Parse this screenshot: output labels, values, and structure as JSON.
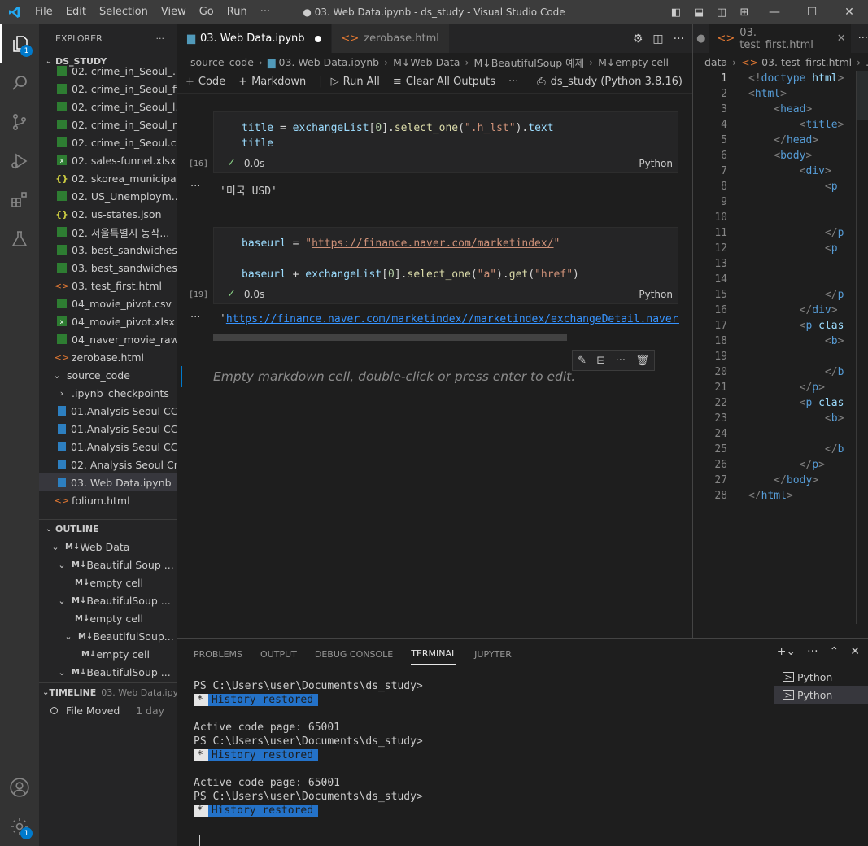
{
  "window": {
    "title": "● 03. Web Data.ipynb - ds_study - Visual Studio Code",
    "menu": [
      "File",
      "Edit",
      "Selection",
      "View",
      "Go",
      "Run",
      "···"
    ]
  },
  "activity": {
    "explorer_badge": "1",
    "settings_badge": "1"
  },
  "explorer": {
    "header": "EXPLORER",
    "header_more": "···",
    "folder": "DS_STUDY",
    "files": [
      {
        "name": "02. crime_in_Seoul_...",
        "type": "csv"
      },
      {
        "name": "02. crime_in_Seoul_fi...",
        "type": "csv"
      },
      {
        "name": "02. crime_in_Seoul_l...",
        "type": "csv"
      },
      {
        "name": "02. crime_in_Seoul_r...",
        "type": "csv"
      },
      {
        "name": "02. crime_in_Seoul.csv",
        "type": "csv"
      },
      {
        "name": "02. sales-funnel.xlsx",
        "type": "xlsx"
      },
      {
        "name": "02. skorea_municipa...",
        "type": "json"
      },
      {
        "name": "02. US_Unemploym...",
        "type": "csv"
      },
      {
        "name": "02. us-states.json",
        "type": "json"
      },
      {
        "name": "02. 서울특별시 동작...",
        "type": "csv"
      },
      {
        "name": "03. best_sandwiches...",
        "type": "csv"
      },
      {
        "name": "03. best_sandwiches...",
        "type": "csv"
      },
      {
        "name": "03. test_first.html",
        "type": "html"
      },
      {
        "name": "04_movie_pivot.csv",
        "type": "csv"
      },
      {
        "name": "04_movie_pivot.xlsx",
        "type": "xlsx"
      },
      {
        "name": "04_naver_movie_raw...",
        "type": "csv"
      },
      {
        "name": "zerobase.html",
        "type": "html"
      }
    ],
    "subfolder": "source_code",
    "subfiles": [
      {
        "name": ".ipynb_checkpoints",
        "type": "folder"
      },
      {
        "name": "01.Analysis Seoul CC...",
        "type": "nb"
      },
      {
        "name": "01.Analysis Seoul CC...",
        "type": "nb"
      },
      {
        "name": "01.Analysis Seoul CC...",
        "type": "nb"
      },
      {
        "name": "02. Analysis Seoul Cr...",
        "type": "nb"
      },
      {
        "name": "03. Web Data.ipynb",
        "type": "nb",
        "selected": true
      },
      {
        "name": "folium.html",
        "type": "html"
      }
    ]
  },
  "outline": {
    "header": "OUTLINE",
    "items": [
      {
        "label": "Web Data",
        "indent": 0,
        "chevron": true
      },
      {
        "label": "Beautiful Soup ...",
        "indent": 1,
        "chevron": true
      },
      {
        "label": "empty cell",
        "indent": 2,
        "chevron": false
      },
      {
        "label": "BeautifulSoup ...",
        "indent": 1,
        "chevron": true
      },
      {
        "label": "empty cell",
        "indent": 2,
        "chevron": false
      },
      {
        "label": "BeautifulSoup...",
        "indent": 2,
        "chevron": true
      },
      {
        "label": "empty cell",
        "indent": 3,
        "chevron": false
      },
      {
        "label": "BeautifulSoup ...",
        "indent": 1,
        "chevron": true
      }
    ]
  },
  "timeline": {
    "header": "TIMELINE",
    "file": "03. Web Data.ipy...",
    "event": "File Moved",
    "when": "1 day"
  },
  "editor1": {
    "tabs": [
      {
        "label": "03. Web Data.ipynb",
        "active": true,
        "dirty": true
      },
      {
        "label": "zerobase.html",
        "active": false
      }
    ],
    "breadcrumb": [
      "source_code",
      "03. Web Data.ipynb",
      "M↓Web Data",
      "M↓BeautifulSoup 예제",
      "M↓empty cell"
    ],
    "toolbar": {
      "code": "Code",
      "markdown": "Markdown",
      "run_all": "Run All",
      "clear_outputs": "Clear All Outputs",
      "more": "···",
      "kernel": "ds_study (Python 3.8.16)"
    },
    "cells": [
      {
        "exec": "[16]",
        "time": "0.0s",
        "lang": "Python",
        "output": "'미국 USD'"
      },
      {
        "exec": "[19]",
        "time": "0.0s",
        "lang": "Python",
        "output_prefix": "'",
        "output_link": "https://finance.naver.com/marketindex//marketindex/exchangeDetail.naver?r"
      }
    ],
    "markdown_placeholder": "Empty markdown cell, double-click or press enter to edit."
  },
  "editor2": {
    "tab": "03. test_first.html",
    "breadcrumb": [
      "data",
      "03. test_first.html",
      "..."
    ],
    "line_numbers": [
      "1",
      "2",
      "3",
      "4",
      "5",
      "6",
      "7",
      "8",
      "9",
      "10",
      "11",
      "12",
      "13",
      "14",
      "15",
      "16",
      "17",
      "18",
      "19",
      "20",
      "21",
      "22",
      "23",
      "24",
      "25",
      "26",
      "27",
      "28"
    ]
  },
  "panel": {
    "tabs": [
      "PROBLEMS",
      "OUTPUT",
      "DEBUG CONSOLE",
      "TERMINAL",
      "JUPYTER"
    ],
    "active_tab": "TERMINAL",
    "prompt": "PS C:\\Users\\user\\Documents\\ds_study>",
    "history": "History restored",
    "codepage": "Active code page: 65001",
    "terminals": [
      "Python",
      "Python"
    ]
  },
  "colors": {
    "accent": "#007acc",
    "link": "#3794ff",
    "string": "#ce9178"
  }
}
